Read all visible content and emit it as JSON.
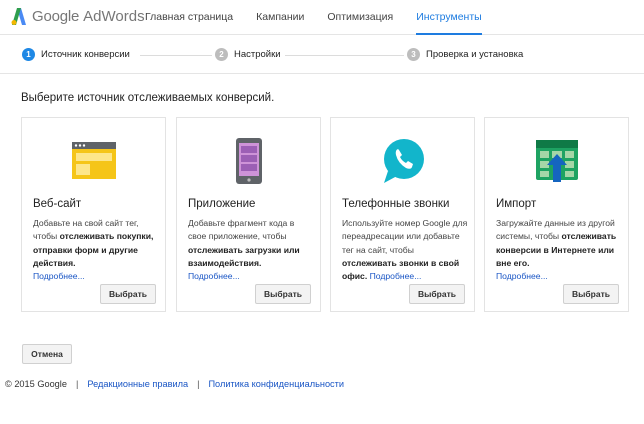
{
  "brand": {
    "google": "Google",
    "product": "AdWords"
  },
  "nav": [
    {
      "label": "Главная страница",
      "active": false
    },
    {
      "label": "Кампании",
      "active": false
    },
    {
      "label": "Оптимизация",
      "active": false
    },
    {
      "label": "Инструменты",
      "active": true
    }
  ],
  "steps": [
    {
      "num": "1",
      "label": "Источник конверсии",
      "active": true
    },
    {
      "num": "2",
      "label": "Настройки",
      "active": false
    },
    {
      "num": "3",
      "label": "Проверка и установка",
      "active": false
    }
  ],
  "heading": "Выберите источник отслеживаемых конверсий.",
  "cards": [
    {
      "icon": "website-icon",
      "title": "Веб-сайт",
      "desc_pre": "Добавьте на свой сайт тег, чтобы ",
      "desc_bold": "отслеживать покупки, отправки форм и другие действия.",
      "desc_post": "",
      "more": "Подробнее...",
      "button": "Выбрать"
    },
    {
      "icon": "app-phone-icon",
      "title": "Приложение",
      "desc_pre": "Добавьте фрагмент кода в свое приложение, чтобы ",
      "desc_bold": "отслеживать загрузки или взаимодействия.",
      "desc_post": "",
      "more": "Подробнее...",
      "button": "Выбрать"
    },
    {
      "icon": "phone-call-icon",
      "title": "Телефонные звонки",
      "desc_pre": "Используйте номер Google для переадресации или добавьте тег на сайт, чтобы ",
      "desc_bold": "отслеживать звонки в свой офис.",
      "desc_post": " ",
      "more": "Подробнее...",
      "button": "Выбрать"
    },
    {
      "icon": "import-icon",
      "title": "Импорт",
      "desc_pre": "Загружайте данные из другой системы, чтобы ",
      "desc_bold": "отслеживать конверсии в Интернете или вне его.",
      "desc_post": "",
      "more": "Подробнее...",
      "button": "Выбрать"
    }
  ],
  "cancel": "Отмена",
  "footer": {
    "copyright": "© 2015 Google",
    "sep": "|",
    "links": [
      "Редакционные правила",
      "Политика конфиденциальности"
    ]
  },
  "colors": {
    "accent": "#1e7ce0",
    "website_yellow": "#f5c518",
    "app_purple": "#9c5fb5",
    "call_cyan": "#12b5cb",
    "import_green": "#1ea362",
    "import_arrow": "#1565c0"
  }
}
